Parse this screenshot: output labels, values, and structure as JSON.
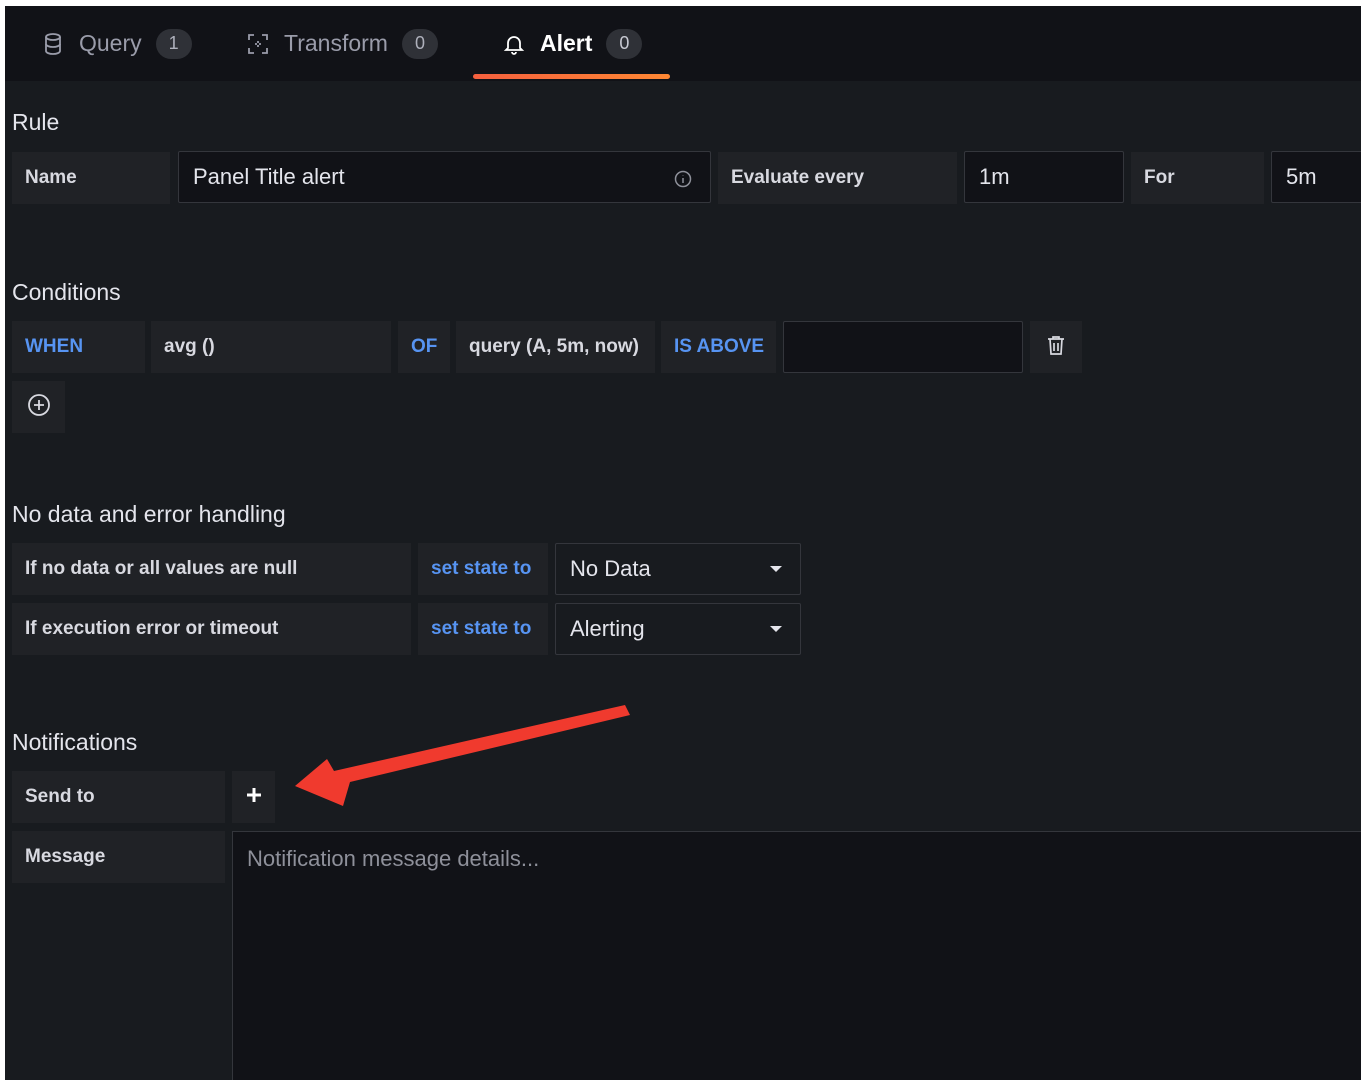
{
  "tabs": [
    {
      "label": "Query",
      "count": "1",
      "icon": "database-icon"
    },
    {
      "label": "Transform",
      "count": "0",
      "icon": "transform-icon"
    },
    {
      "label": "Alert",
      "count": "0",
      "icon": "bell-icon",
      "active": true
    }
  ],
  "rule": {
    "title": "Rule",
    "name_label": "Name",
    "name_value": "Panel Title alert",
    "evaluate_label": "Evaluate every",
    "evaluate_value": "1m",
    "for_label": "For",
    "for_value": "5m"
  },
  "conditions": {
    "title": "Conditions",
    "when": "WHEN",
    "reducer": "avg ()",
    "of": "OF",
    "query": "query (A, 5m, now)",
    "evaluator": "IS ABOVE",
    "threshold": ""
  },
  "nodata": {
    "title": "No data and error handling",
    "rows": [
      {
        "label": "If no data or all values are null",
        "action": "set state to",
        "value": "No Data"
      },
      {
        "label": "If execution error or timeout",
        "action": "set state to",
        "value": "Alerting"
      }
    ]
  },
  "notifications": {
    "title": "Notifications",
    "send_to_label": "Send to",
    "message_label": "Message",
    "message_placeholder": "Notification message details..."
  },
  "colors": {
    "background": "#181b1f",
    "accent": "#ff8833",
    "link_blue": "#5794f2",
    "annotation_arrow": "#f03a2e"
  }
}
